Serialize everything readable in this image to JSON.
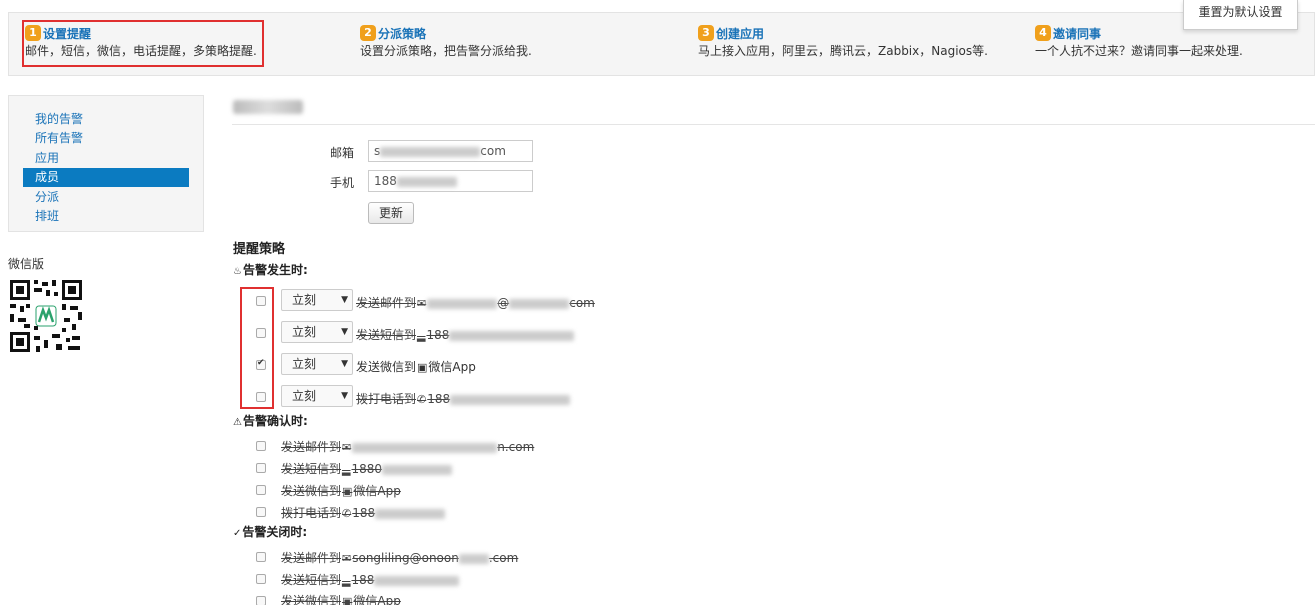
{
  "steps": [
    {
      "num": "1",
      "title": "设置提醒",
      "desc": "邮件，短信，微信，电话提醒，多策略提醒."
    },
    {
      "num": "2",
      "title": "分派策略",
      "desc": "设置分派策略，把告警分派给我."
    },
    {
      "num": "3",
      "title": "创建应用",
      "desc": "马上接入应用，阿里云，腾讯云，Zabbix，Nagios等."
    },
    {
      "num": "4",
      "title": "邀请同事",
      "desc": "一个人抗不过来？邀请同事一起来处理."
    }
  ],
  "reset_button": "重置为默认设置",
  "sidebar": {
    "items": [
      {
        "label": "我的告警"
      },
      {
        "label": "所有告警"
      },
      {
        "label": "应用"
      },
      {
        "label": "成员",
        "active": true
      },
      {
        "label": "分派"
      },
      {
        "label": "排班"
      }
    ],
    "wechat_label": "微信版"
  },
  "profile": {
    "email_label": "邮箱",
    "email_prefix": "s",
    "email_suffix": "com",
    "phone_label": "手机",
    "phone_prefix": "188",
    "update_button": "更新"
  },
  "policy": {
    "title": "提醒策略",
    "on_trigger": {
      "title": "告警发生时:",
      "select_value": "立刻",
      "rows": [
        {
          "prefix": "发送邮件到",
          "icon": "✉",
          "tail": "@",
          "suffix": "com",
          "checked": false,
          "strike": true
        },
        {
          "prefix": "发送短信到",
          "icon": "▬",
          "tail": "188",
          "suffix": "",
          "checked": false,
          "strike": true
        },
        {
          "prefix": "发送微信到",
          "icon": "▣",
          "tail": "微信App",
          "suffix": "",
          "checked": true,
          "strike": false
        },
        {
          "prefix": "拨打电话到",
          "icon": "✆",
          "tail": "188",
          "suffix": "",
          "checked": false,
          "strike": true
        }
      ]
    },
    "on_ack": {
      "title": "告警确认时:",
      "rows": [
        {
          "prefix": "发送邮件到",
          "icon": "✉",
          "tail": "",
          "suffix": "n.com"
        },
        {
          "prefix": "发送短信到",
          "icon": "▬",
          "tail": "1880",
          "suffix": ""
        },
        {
          "prefix": "发送微信到",
          "icon": "▣",
          "tail": "微信App",
          "suffix": ""
        },
        {
          "prefix": "拨打电话到",
          "icon": "✆",
          "tail": "188",
          "suffix": ""
        }
      ]
    },
    "on_close": {
      "title": "告警关闭时:",
      "rows": [
        {
          "prefix": "发送邮件到",
          "icon": "✉",
          "tail": "songliling@onoon",
          "suffix": ".com"
        },
        {
          "prefix": "发送短信到",
          "icon": "▬",
          "tail": "188",
          "suffix": ""
        },
        {
          "prefix": "发送微信到",
          "icon": "▣",
          "tail": "微信App",
          "suffix": ""
        }
      ]
    }
  }
}
